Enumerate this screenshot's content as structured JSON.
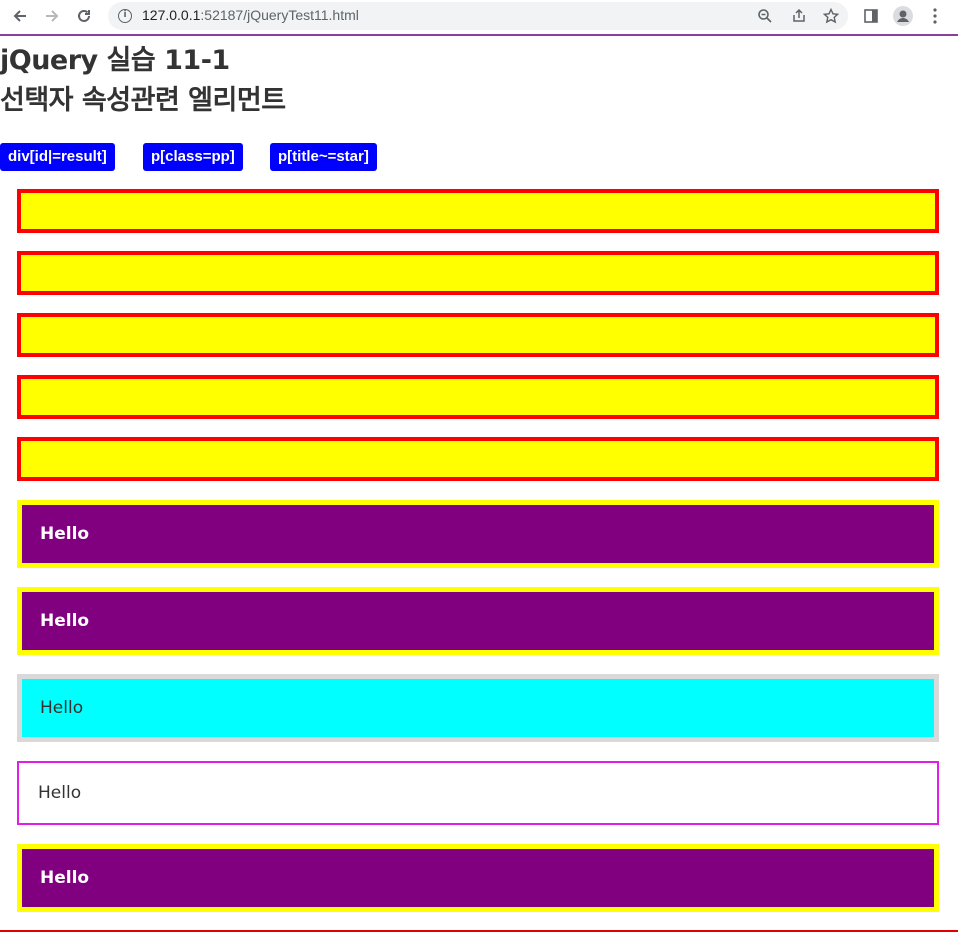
{
  "browser": {
    "url_host": "127.0.0.1",
    "url_rest": ":52187/jQueryTest11.html"
  },
  "page": {
    "title_line1": "jQuery 실습 11-1",
    "title_line2": "선택자 속성관련 엘리먼트"
  },
  "buttons": [
    {
      "label": "div[id|=result]"
    },
    {
      "label": "p[class=pp]"
    },
    {
      "label": "p[title~=star]"
    }
  ],
  "paragraphs": [
    {
      "text": "Hello",
      "style": "purple"
    },
    {
      "text": "Hello",
      "style": "purple"
    },
    {
      "text": "Hello",
      "style": "cyan"
    },
    {
      "text": "Hello",
      "style": "white"
    },
    {
      "text": "Hello",
      "style": "purple"
    }
  ],
  "colors": {
    "button": "#0000ff",
    "result_box_fill": "#ffff00",
    "result_box_border": "#ff0000",
    "paragraph_purple": "#800080",
    "paragraph_cyan": "#00ffff",
    "paragraph_white_border": "#e21ee6"
  }
}
